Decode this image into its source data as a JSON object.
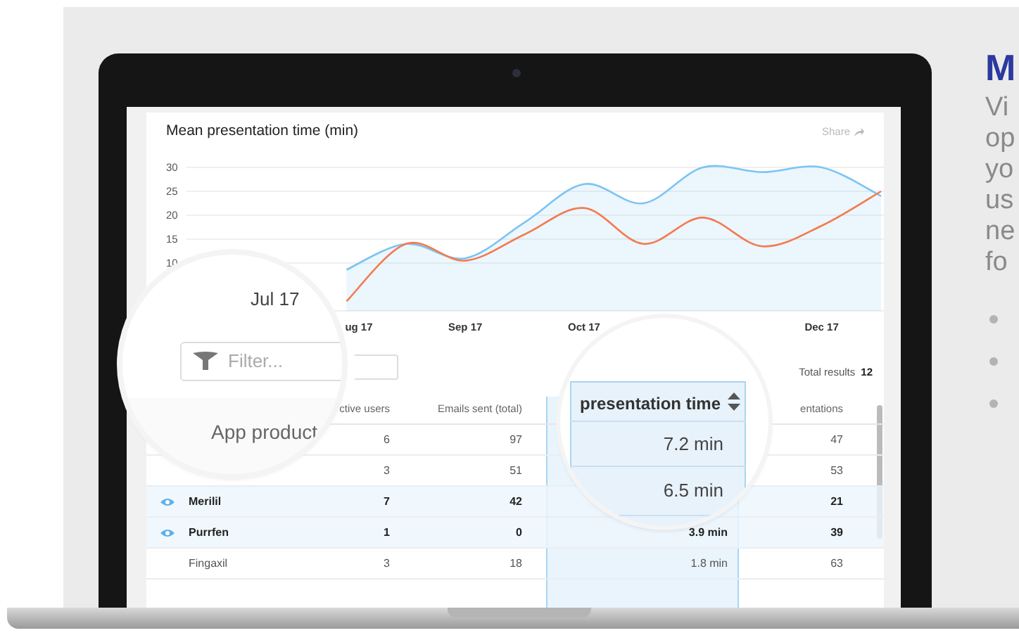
{
  "laptop_screen": {
    "chart": {
      "title": "Mean presentation time (min)",
      "share": "Share",
      "chart_data": {
        "type": "area",
        "grid": true,
        "categories": [
          null,
          "ug 17",
          null,
          "Sep 17",
          null,
          "Oct 17",
          null,
          null,
          null,
          "Dec 17",
          null
        ],
        "series": [
          {
            "color": "#7cc4f2",
            "values": [
              null,
              8.6,
              14,
              11,
              18.5,
              26.5,
              22.5,
              30,
              29,
              30,
              24
            ]
          },
          {
            "color": "#f47a4e",
            "type": "line",
            "values": [
              null,
              2,
              14,
              10.5,
              16,
              21.5,
              14,
              19.5,
              13.5,
              17.8,
              25
            ]
          }
        ],
        "ylim": [
          0,
          30
        ],
        "yticks": [
          10,
          15,
          20,
          25,
          30
        ]
      }
    },
    "results": {
      "label": "Total results",
      "count": "12"
    },
    "table": {
      "headers": {
        "active_users": "ctive users",
        "emails_sent": "Emails sent (total)",
        "column_6": "entations"
      },
      "rows": [
        {
          "selected": false,
          "active_users": "6",
          "emails_sent": "97",
          "column_6": "47"
        },
        {
          "selected": false,
          "active_users": "3",
          "emails_sent": "51",
          "column_6": "53"
        },
        {
          "selected": true,
          "product": "Merilil",
          "active_users": "7",
          "emails_sent": "42",
          "column_6": "21"
        },
        {
          "selected": true,
          "product": "Purrfen",
          "active_users": "1",
          "emails_sent": "0",
          "presentation_time": "3.9 min",
          "column_6": "39"
        },
        {
          "selected": false,
          "product": "Fingaxil",
          "active_users": "3",
          "emails_sent": "18",
          "presentation_time": "1.8 min",
          "column_6": "63"
        }
      ]
    },
    "magnifier_left": {
      "date": "Jul 17",
      "filter_placeholder": "Filter...",
      "column": "App product"
    },
    "magnifier_right": {
      "header": "presentation time",
      "values": [
        "7.2 min",
        "6.5 min"
      ]
    }
  },
  "side": {
    "heading": "M",
    "paragraph_lines": [
      "Vi",
      "op",
      "yo",
      "us",
      "ne",
      "fo"
    ],
    "bullets": [
      {
        "kind": "dot"
      },
      {
        "kind": "dot"
      },
      {
        "kind": "dot"
      }
    ]
  }
}
